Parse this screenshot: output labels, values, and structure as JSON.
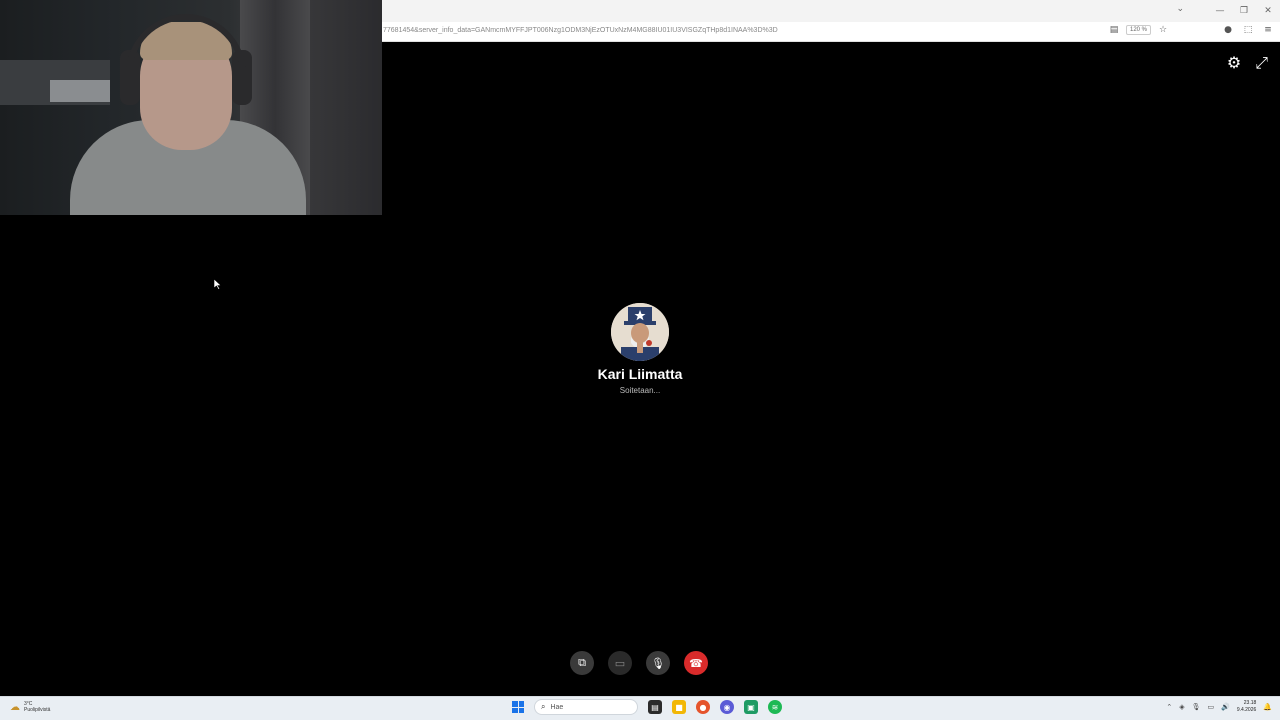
{
  "browser": {
    "url": "77681454&server_info_data=GANmcmMYFFJPT006Nzg1ODM3NjEzOTUxNzM4MG88IU01IU3VISGZqTHp8d1INAA%3D%3D",
    "zoom": "120 %",
    "window_controls": [
      "—",
      "❐",
      "✕"
    ],
    "tab_menu": "⌄"
  },
  "call": {
    "caller_name": "Kari Liimatta",
    "status": "Soitetaan...",
    "top_icons": [
      "gear-icon",
      "expand-icon"
    ],
    "controls": [
      {
        "name": "screen-share-button",
        "glyph": "⧉"
      },
      {
        "name": "video-off-button",
        "glyph": "▭"
      },
      {
        "name": "microphone-button",
        "glyph": "🎙"
      },
      {
        "name": "end-call-button",
        "glyph": "☎"
      }
    ],
    "end_call_color": "#d92b2b"
  },
  "taskbar": {
    "weather_temp": "3°C",
    "weather_desc": "Puolipilvistä",
    "search_placeholder": "Hae",
    "time": "23.18",
    "date": "9.4.2026",
    "apps": [
      {
        "name": "file-explorer-icon",
        "color": "#2b2b2b",
        "glyph": "▤"
      },
      {
        "name": "folder-icon",
        "color": "#f2b705",
        "glyph": "■"
      },
      {
        "name": "firefox-icon",
        "color": "#e5542c",
        "glyph": "●"
      },
      {
        "name": "messenger-icon",
        "color": "#5b5bd6",
        "glyph": "◉"
      },
      {
        "name": "teams-icon",
        "color": "#1e9b64",
        "glyph": "▣"
      },
      {
        "name": "spotify-icon",
        "color": "#1db954",
        "glyph": "≋"
      }
    ]
  }
}
